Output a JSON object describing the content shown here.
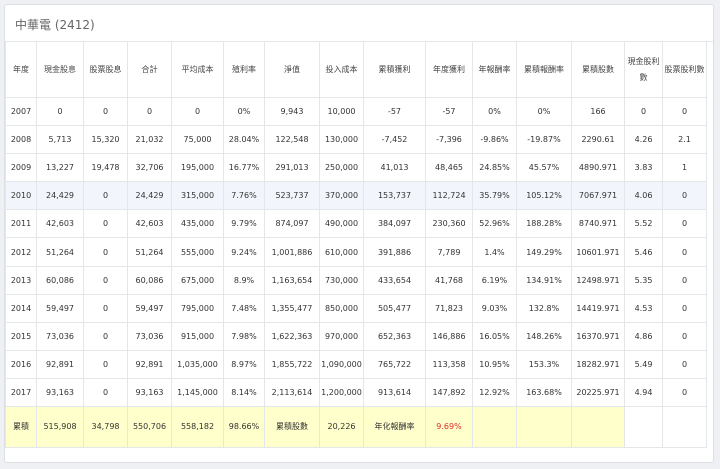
{
  "title": "中華電 (2412)",
  "headers": [
    "年度",
    "現金股息",
    "股票股息",
    "合計",
    "平均成本",
    "殖利率",
    "淨值",
    "投入成本",
    "累積獲利",
    "年度獲利",
    "年報酬率",
    "累積報酬率",
    "累積股數",
    "現金股利數",
    "股票股利數"
  ],
  "rows": [
    [
      "2007",
      "0",
      "0",
      "0",
      "0",
      "0%",
      "9,943",
      "10,000",
      "-57",
      "-57",
      "0%",
      "0%",
      "166",
      "0",
      "0"
    ],
    [
      "2008",
      "5,713",
      "15,320",
      "21,032",
      "75,000",
      "28.04%",
      "122,548",
      "130,000",
      "-7,452",
      "-7,396",
      "-9.86%",
      "-19.87%",
      "2290.61",
      "4.26",
      "2.1"
    ],
    [
      "2009",
      "13,227",
      "19,478",
      "32,706",
      "195,000",
      "16.77%",
      "291,013",
      "250,000",
      "41,013",
      "48,465",
      "24.85%",
      "45.57%",
      "4890.971",
      "3.83",
      "1"
    ],
    [
      "2010",
      "24,429",
      "0",
      "24,429",
      "315,000",
      "7.76%",
      "523,737",
      "370,000",
      "153,737",
      "112,724",
      "35.79%",
      "105.12%",
      "7067.971",
      "4.06",
      "0"
    ],
    [
      "2011",
      "42,603",
      "0",
      "42,603",
      "435,000",
      "9.79%",
      "874,097",
      "490,000",
      "384,097",
      "230,360",
      "52.96%",
      "188.28%",
      "8740.971",
      "5.52",
      "0"
    ],
    [
      "2012",
      "51,264",
      "0",
      "51,264",
      "555,000",
      "9.24%",
      "1,001,886",
      "610,000",
      "391,886",
      "7,789",
      "1.4%",
      "149.29%",
      "10601.971",
      "5.46",
      "0"
    ],
    [
      "2013",
      "60,086",
      "0",
      "60,086",
      "675,000",
      "8.9%",
      "1,163,654",
      "730,000",
      "433,654",
      "41,768",
      "6.19%",
      "134.91%",
      "12498.971",
      "5.35",
      "0"
    ],
    [
      "2014",
      "59,497",
      "0",
      "59,497",
      "795,000",
      "7.48%",
      "1,355,477",
      "850,000",
      "505,477",
      "71,823",
      "9.03%",
      "132.8%",
      "14419.971",
      "4.53",
      "0"
    ],
    [
      "2015",
      "73,036",
      "0",
      "73,036",
      "915,000",
      "7.98%",
      "1,622,363",
      "970,000",
      "652,363",
      "146,886",
      "16.05%",
      "148.26%",
      "16370.971",
      "4.86",
      "0"
    ],
    [
      "2016",
      "92,891",
      "0",
      "92,891",
      "1,035,000",
      "8.97%",
      "1,855,722",
      "1,090,000",
      "765,722",
      "113,358",
      "10.95%",
      "153.3%",
      "18282.971",
      "5.49",
      "0"
    ],
    [
      "2017",
      "93,163",
      "0",
      "93,163",
      "1,145,000",
      "8.14%",
      "2,113,614",
      "1,200,000",
      "913,614",
      "147,892",
      "12.92%",
      "163.68%",
      "20225.971",
      "4.94",
      "0"
    ]
  ],
  "summary": {
    "label": "累積",
    "cash": "515,908",
    "stock": "34,798",
    "total": "550,706",
    "avg_cost": "558,182",
    "yield": "98.66%",
    "shares_label": "累積股數",
    "shares": "20,226",
    "return_label": "年化報酬率",
    "return_value": "9.69%"
  },
  "colors": {
    "highlight_row": "#f2f6fc",
    "summary_bg": "#ffffcc",
    "return_red": "#e12b2b"
  }
}
